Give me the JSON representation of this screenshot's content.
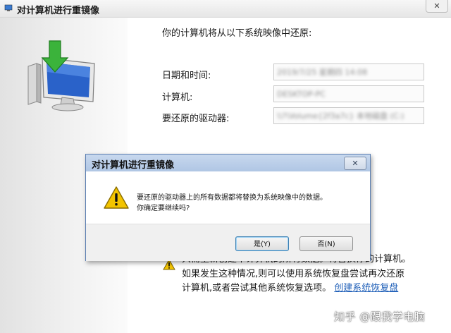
{
  "wizard": {
    "title": "对计算机进行重镜像",
    "close_glyph": "✕",
    "intro": "你的计算机将从以下系统映像中还原:",
    "fields": {
      "date_label": "日期和时间:",
      "date_value": "2019/7/25 星期四 14:08",
      "computer_label": "计算机:",
      "computer_value": "DESKTOP-PC",
      "drive_label": "要还原的驱动器:",
      "drive_value": "\\\\?\\Volume{2f3a7c} 本地磁盘 (C:)"
    },
    "warning": {
      "line1": "只需重新创建本计算机的所有数据。将替换你的计算机。",
      "line2": "如果发生这种情况,则可以使用系统恢复盘尝试再次还原",
      "line3_text": "计算机,或者尝试其他系统恢复选项。",
      "line3_link": "创建系统恢复盘"
    },
    "icons": {
      "sidebar": "computer-restore-icon",
      "warning": "warning-icon"
    }
  },
  "dialog": {
    "title": "对计算机进行重镜像",
    "close_glyph": "✕",
    "message_line1": "要还原的驱动器上的所有数据都将替换为系统映像中的数据。",
    "message_line2": "你确定要继续吗?",
    "yes_label": "是(Y)",
    "no_label": "否(N)"
  },
  "watermark": "知乎 @跟我学电脑",
  "colors": {
    "link": "#1f5fb8",
    "dialog_title_bg": "#b9cde8",
    "warning_yellow": "#f3c400"
  }
}
